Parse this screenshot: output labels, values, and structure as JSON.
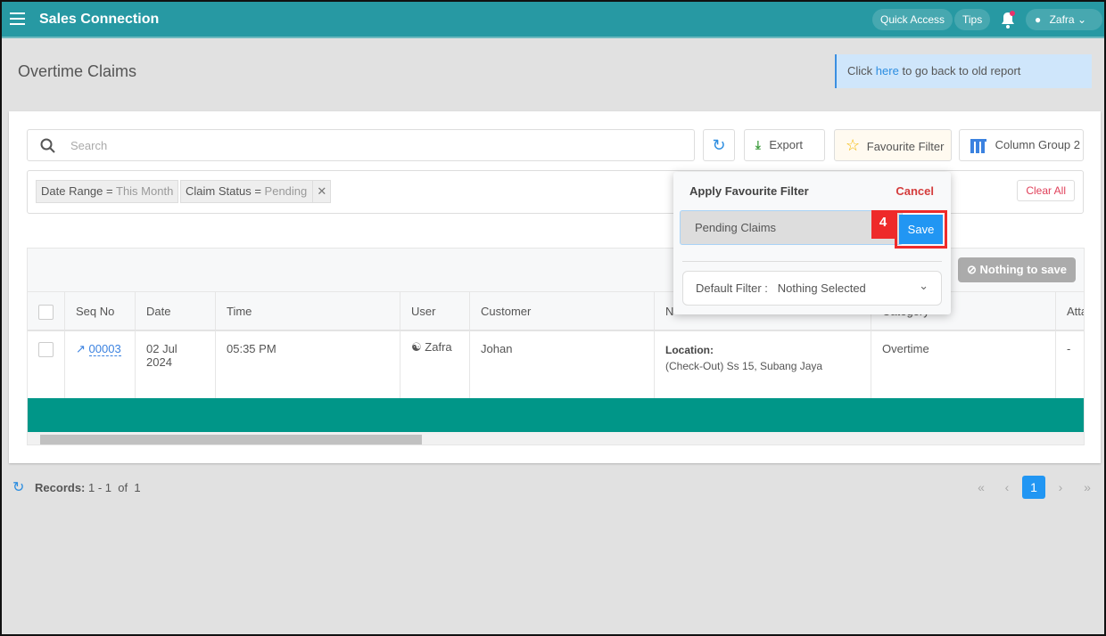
{
  "header": {
    "brand": "Sales Connection",
    "quick_access": "Quick Access",
    "tips": "Tips",
    "user": "Zafra",
    "accent": "#2799a3"
  },
  "page": {
    "title": "Overtime Claims",
    "notice_pre": "Click",
    "notice_link": "here",
    "notice_post": "to go back to old report"
  },
  "toolbar": {
    "search_placeholder": "Search",
    "export": "Export",
    "favourite": "Favourite Filter",
    "column_group": "Column Group 2"
  },
  "filters": [
    {
      "field": "Date Range",
      "op": "=",
      "value": "This Month"
    },
    {
      "field": "Claim Status",
      "op": "=",
      "value": "Pending"
    }
  ],
  "clear_all": "Clear All",
  "nothing_to_save": "Nothing to save",
  "popup": {
    "title": "Apply Favourite Filter",
    "cancel": "Cancel",
    "name_value": "Pending Claims",
    "step": "4",
    "save": "Save",
    "default_label": "Default Filter :",
    "default_value": "Nothing Selected"
  },
  "table": {
    "columns": [
      "Seq No",
      "Date",
      "Time",
      "User",
      "Customer",
      "N",
      "Category",
      "Atta"
    ],
    "rows": [
      {
        "seq": "00003",
        "date": "02 Jul 2024",
        "time": "05:35 PM",
        "user": "Zafra",
        "customer": "Johan",
        "note_label": "Location:",
        "note_text": "(Check-Out) Ss 15, Subang Jaya",
        "category": "Overtime",
        "attachment": "-"
      }
    ]
  },
  "footer": {
    "records_label": "Records:",
    "records_range": "1 - 1",
    "of": "of",
    "total": "1",
    "current_page": "1"
  }
}
